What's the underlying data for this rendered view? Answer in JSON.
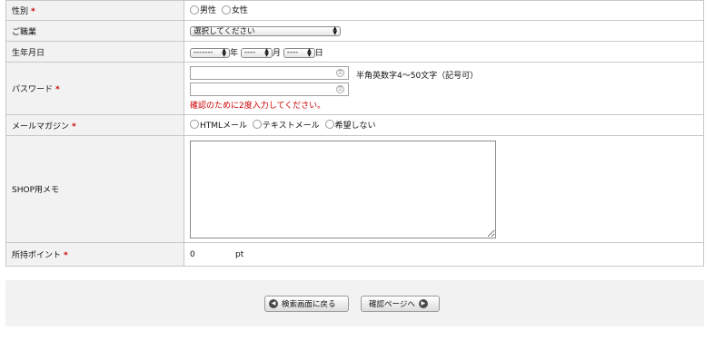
{
  "required_mark": "*",
  "gender": {
    "label": "性別",
    "options": [
      "男性",
      "女性"
    ]
  },
  "occupation": {
    "label": "ご職業",
    "selected": "選択してください"
  },
  "birthday": {
    "label": "生年月日",
    "year_value": "-------",
    "year_unit": "年",
    "month_value": "----",
    "month_unit": "月",
    "day_value": "----",
    "day_unit": "日"
  },
  "password": {
    "label": "パスワード",
    "note": "半角英数字4～50文字（記号可）",
    "confirm_note": "確認のために2度入力してください。"
  },
  "newsletter": {
    "label": "メールマガジン",
    "options": [
      "HTMLメール",
      "テキストメール",
      "希望しない"
    ]
  },
  "shop_memo": {
    "label": "SHOP用メモ"
  },
  "points": {
    "label": "所持ポイント",
    "value": "0",
    "unit": "pt"
  },
  "buttons": {
    "back": "検索画面に戻る",
    "confirm": "確認ページへ"
  }
}
